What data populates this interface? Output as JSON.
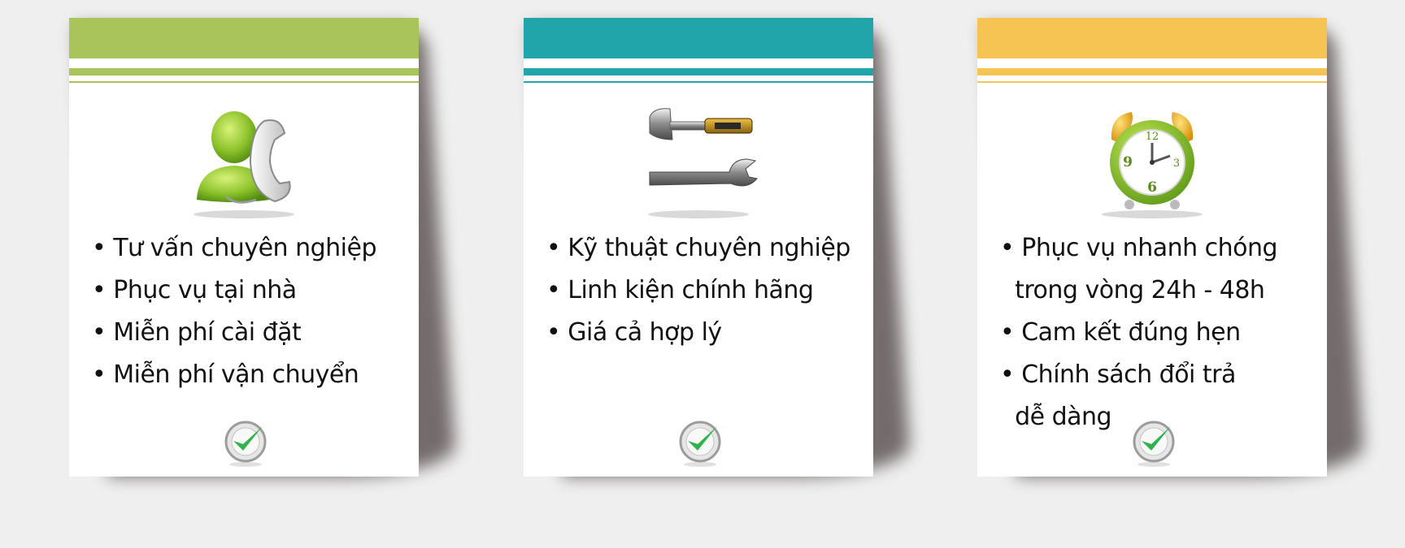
{
  "cards": [
    {
      "icon": "customer-support-icon",
      "color": "#a9c45a",
      "lines": [
        "• Tư vấn chuyên nghiệp",
        "• Phục vụ tại nhà",
        "• Miễn phí cài đặt",
        "• Miễn phí vận chuyển"
      ]
    },
    {
      "icon": "hammer-wrench-icon",
      "color": "#21a5aa",
      "lines": [
        "• Kỹ thuật chuyên nghiệp",
        "• Linh kiện chính hãng",
        "• Giá cả hợp lý"
      ]
    },
    {
      "icon": "alarm-clock-icon",
      "color": "#f5c453",
      "clock_numerals": [
        "12",
        "3",
        "6",
        "9"
      ],
      "lines": [
        "• Phục vụ nhanh chóng",
        "  trong vòng 24h - 48h",
        "• Cam kết đúng hẹn",
        "• Chính sách đổi trả",
        "  dễ dàng"
      ]
    }
  ],
  "check_icon": "checkmark-badge-icon",
  "check_color": "#2fb34a"
}
